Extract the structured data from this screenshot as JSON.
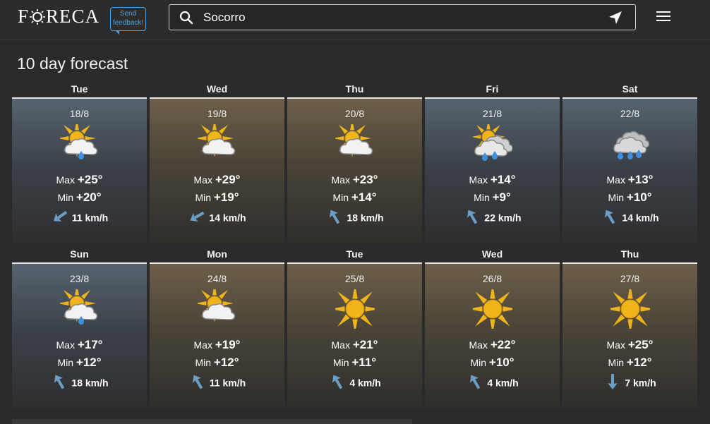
{
  "header": {
    "logo_pre": "F",
    "logo_post": "RECA",
    "feedback_line1": "Send",
    "feedback_line2": "feedback!",
    "search_value": "Socorro"
  },
  "page_title": "10 day forecast",
  "colors": {
    "accent": "#4aa3df",
    "sun": "#f0b51a",
    "rain": "#3f8fe0",
    "wind_arrow": "#6b9ec6"
  },
  "days": [
    {
      "day": "Tue",
      "date": "18/8",
      "icon": "partly-cloudy-rain-icon",
      "max": "+25°",
      "min": "+20°",
      "wind": "11 km/h",
      "wind_dir": 235,
      "bg": "rain"
    },
    {
      "day": "Wed",
      "date": "19/8",
      "icon": "partly-cloudy-icon",
      "max": "+29°",
      "min": "+19°",
      "wind": "14 km/h",
      "wind_dir": 240,
      "bg": "sun"
    },
    {
      "day": "Thu",
      "date": "20/8",
      "icon": "partly-cloudy-icon",
      "max": "+23°",
      "min": "+14°",
      "wind": "18 km/h",
      "wind_dir": 330,
      "bg": "sun"
    },
    {
      "day": "Fri",
      "date": "21/8",
      "icon": "partly-cloudy-showers-icon",
      "max": "+14°",
      "min": "+9°",
      "wind": "22 km/h",
      "wind_dir": 330,
      "bg": "rain"
    },
    {
      "day": "Sat",
      "date": "22/8",
      "icon": "cloudy-rain-icon",
      "max": "+13°",
      "min": "+10°",
      "wind": "14 km/h",
      "wind_dir": 330,
      "bg": "rain"
    },
    {
      "day": "Sun",
      "date": "23/8",
      "icon": "partly-cloudy-rain-icon",
      "max": "+17°",
      "min": "+12°",
      "wind": "18 km/h",
      "wind_dir": 330,
      "bg": "rain"
    },
    {
      "day": "Mon",
      "date": "24/8",
      "icon": "partly-cloudy-icon",
      "max": "+19°",
      "min": "+12°",
      "wind": "11 km/h",
      "wind_dir": 330,
      "bg": "sun"
    },
    {
      "day": "Tue",
      "date": "25/8",
      "icon": "sun-icon",
      "max": "+21°",
      "min": "+11°",
      "wind": "4 km/h",
      "wind_dir": 330,
      "bg": "sun"
    },
    {
      "day": "Wed",
      "date": "26/8",
      "icon": "sun-icon",
      "max": "+22°",
      "min": "+10°",
      "wind": "4 km/h",
      "wind_dir": 330,
      "bg": "sun"
    },
    {
      "day": "Thu",
      "date": "27/8",
      "icon": "sun-icon",
      "max": "+25°",
      "min": "+12°",
      "wind": "7 km/h",
      "wind_dir": 180,
      "bg": "sun"
    }
  ],
  "labels": {
    "max": "Max",
    "min": "Min"
  }
}
